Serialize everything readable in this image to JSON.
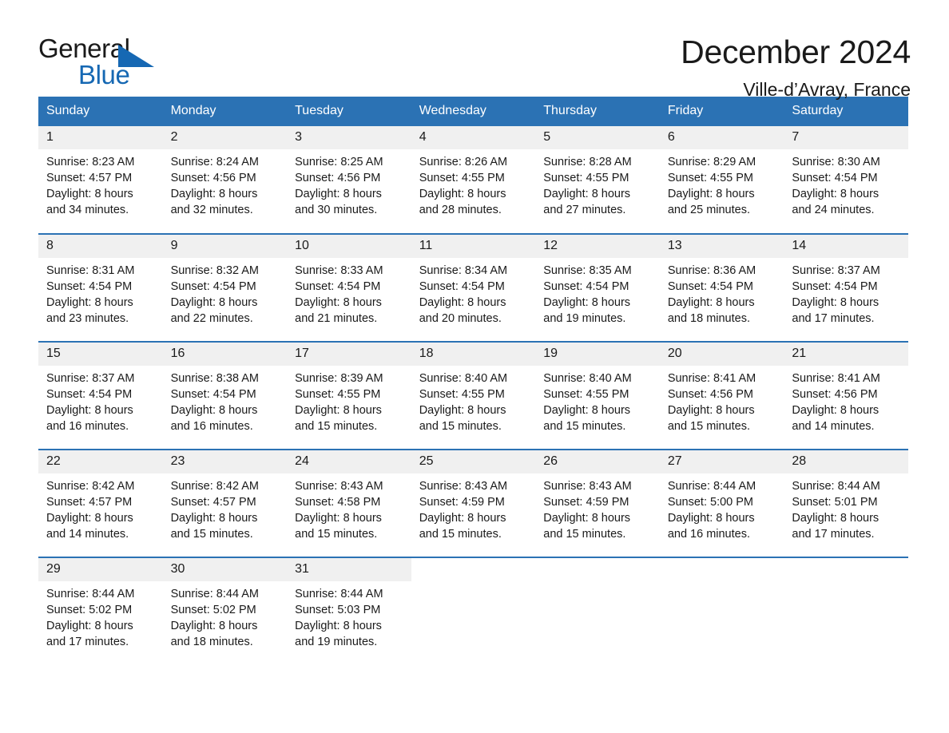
{
  "brand": {
    "name_part1": "General",
    "name_part2": "Blue",
    "triangle_color": "#1668b3",
    "accent_color": "#2b72b4"
  },
  "header": {
    "title": "December 2024",
    "subtitle": "Ville-d’Avray, France"
  },
  "calendar": {
    "weekday_headers": [
      "Sunday",
      "Monday",
      "Tuesday",
      "Wednesday",
      "Thursday",
      "Friday",
      "Saturday"
    ],
    "weeks": [
      [
        {
          "day": "1",
          "sunrise": "Sunrise: 8:23 AM",
          "sunset": "Sunset: 4:57 PM",
          "daylight_line1": "Daylight: 8 hours",
          "daylight_line2": "and 34 minutes."
        },
        {
          "day": "2",
          "sunrise": "Sunrise: 8:24 AM",
          "sunset": "Sunset: 4:56 PM",
          "daylight_line1": "Daylight: 8 hours",
          "daylight_line2": "and 32 minutes."
        },
        {
          "day": "3",
          "sunrise": "Sunrise: 8:25 AM",
          "sunset": "Sunset: 4:56 PM",
          "daylight_line1": "Daylight: 8 hours",
          "daylight_line2": "and 30 minutes."
        },
        {
          "day": "4",
          "sunrise": "Sunrise: 8:26 AM",
          "sunset": "Sunset: 4:55 PM",
          "daylight_line1": "Daylight: 8 hours",
          "daylight_line2": "and 28 minutes."
        },
        {
          "day": "5",
          "sunrise": "Sunrise: 8:28 AM",
          "sunset": "Sunset: 4:55 PM",
          "daylight_line1": "Daylight: 8 hours",
          "daylight_line2": "and 27 minutes."
        },
        {
          "day": "6",
          "sunrise": "Sunrise: 8:29 AM",
          "sunset": "Sunset: 4:55 PM",
          "daylight_line1": "Daylight: 8 hours",
          "daylight_line2": "and 25 minutes."
        },
        {
          "day": "7",
          "sunrise": "Sunrise: 8:30 AM",
          "sunset": "Sunset: 4:54 PM",
          "daylight_line1": "Daylight: 8 hours",
          "daylight_line2": "and 24 minutes."
        }
      ],
      [
        {
          "day": "8",
          "sunrise": "Sunrise: 8:31 AM",
          "sunset": "Sunset: 4:54 PM",
          "daylight_line1": "Daylight: 8 hours",
          "daylight_line2": "and 23 minutes."
        },
        {
          "day": "9",
          "sunrise": "Sunrise: 8:32 AM",
          "sunset": "Sunset: 4:54 PM",
          "daylight_line1": "Daylight: 8 hours",
          "daylight_line2": "and 22 minutes."
        },
        {
          "day": "10",
          "sunrise": "Sunrise: 8:33 AM",
          "sunset": "Sunset: 4:54 PM",
          "daylight_line1": "Daylight: 8 hours",
          "daylight_line2": "and 21 minutes."
        },
        {
          "day": "11",
          "sunrise": "Sunrise: 8:34 AM",
          "sunset": "Sunset: 4:54 PM",
          "daylight_line1": "Daylight: 8 hours",
          "daylight_line2": "and 20 minutes."
        },
        {
          "day": "12",
          "sunrise": "Sunrise: 8:35 AM",
          "sunset": "Sunset: 4:54 PM",
          "daylight_line1": "Daylight: 8 hours",
          "daylight_line2": "and 19 minutes."
        },
        {
          "day": "13",
          "sunrise": "Sunrise: 8:36 AM",
          "sunset": "Sunset: 4:54 PM",
          "daylight_line1": "Daylight: 8 hours",
          "daylight_line2": "and 18 minutes."
        },
        {
          "day": "14",
          "sunrise": "Sunrise: 8:37 AM",
          "sunset": "Sunset: 4:54 PM",
          "daylight_line1": "Daylight: 8 hours",
          "daylight_line2": "and 17 minutes."
        }
      ],
      [
        {
          "day": "15",
          "sunrise": "Sunrise: 8:37 AM",
          "sunset": "Sunset: 4:54 PM",
          "daylight_line1": "Daylight: 8 hours",
          "daylight_line2": "and 16 minutes."
        },
        {
          "day": "16",
          "sunrise": "Sunrise: 8:38 AM",
          "sunset": "Sunset: 4:54 PM",
          "daylight_line1": "Daylight: 8 hours",
          "daylight_line2": "and 16 minutes."
        },
        {
          "day": "17",
          "sunrise": "Sunrise: 8:39 AM",
          "sunset": "Sunset: 4:55 PM",
          "daylight_line1": "Daylight: 8 hours",
          "daylight_line2": "and 15 minutes."
        },
        {
          "day": "18",
          "sunrise": "Sunrise: 8:40 AM",
          "sunset": "Sunset: 4:55 PM",
          "daylight_line1": "Daylight: 8 hours",
          "daylight_line2": "and 15 minutes."
        },
        {
          "day": "19",
          "sunrise": "Sunrise: 8:40 AM",
          "sunset": "Sunset: 4:55 PM",
          "daylight_line1": "Daylight: 8 hours",
          "daylight_line2": "and 15 minutes."
        },
        {
          "day": "20",
          "sunrise": "Sunrise: 8:41 AM",
          "sunset": "Sunset: 4:56 PM",
          "daylight_line1": "Daylight: 8 hours",
          "daylight_line2": "and 15 minutes."
        },
        {
          "day": "21",
          "sunrise": "Sunrise: 8:41 AM",
          "sunset": "Sunset: 4:56 PM",
          "daylight_line1": "Daylight: 8 hours",
          "daylight_line2": "and 14 minutes."
        }
      ],
      [
        {
          "day": "22",
          "sunrise": "Sunrise: 8:42 AM",
          "sunset": "Sunset: 4:57 PM",
          "daylight_line1": "Daylight: 8 hours",
          "daylight_line2": "and 14 minutes."
        },
        {
          "day": "23",
          "sunrise": "Sunrise: 8:42 AM",
          "sunset": "Sunset: 4:57 PM",
          "daylight_line1": "Daylight: 8 hours",
          "daylight_line2": "and 15 minutes."
        },
        {
          "day": "24",
          "sunrise": "Sunrise: 8:43 AM",
          "sunset": "Sunset: 4:58 PM",
          "daylight_line1": "Daylight: 8 hours",
          "daylight_line2": "and 15 minutes."
        },
        {
          "day": "25",
          "sunrise": "Sunrise: 8:43 AM",
          "sunset": "Sunset: 4:59 PM",
          "daylight_line1": "Daylight: 8 hours",
          "daylight_line2": "and 15 minutes."
        },
        {
          "day": "26",
          "sunrise": "Sunrise: 8:43 AM",
          "sunset": "Sunset: 4:59 PM",
          "daylight_line1": "Daylight: 8 hours",
          "daylight_line2": "and 15 minutes."
        },
        {
          "day": "27",
          "sunrise": "Sunrise: 8:44 AM",
          "sunset": "Sunset: 5:00 PM",
          "daylight_line1": "Daylight: 8 hours",
          "daylight_line2": "and 16 minutes."
        },
        {
          "day": "28",
          "sunrise": "Sunrise: 8:44 AM",
          "sunset": "Sunset: 5:01 PM",
          "daylight_line1": "Daylight: 8 hours",
          "daylight_line2": "and 17 minutes."
        }
      ],
      [
        {
          "day": "29",
          "sunrise": "Sunrise: 8:44 AM",
          "sunset": "Sunset: 5:02 PM",
          "daylight_line1": "Daylight: 8 hours",
          "daylight_line2": "and 17 minutes."
        },
        {
          "day": "30",
          "sunrise": "Sunrise: 8:44 AM",
          "sunset": "Sunset: 5:02 PM",
          "daylight_line1": "Daylight: 8 hours",
          "daylight_line2": "and 18 minutes."
        },
        {
          "day": "31",
          "sunrise": "Sunrise: 8:44 AM",
          "sunset": "Sunset: 5:03 PM",
          "daylight_line1": "Daylight: 8 hours",
          "daylight_line2": "and 19 minutes."
        },
        {
          "day": "",
          "sunrise": "",
          "sunset": "",
          "daylight_line1": "",
          "daylight_line2": ""
        },
        {
          "day": "",
          "sunrise": "",
          "sunset": "",
          "daylight_line1": "",
          "daylight_line2": ""
        },
        {
          "day": "",
          "sunrise": "",
          "sunset": "",
          "daylight_line1": "",
          "daylight_line2": ""
        },
        {
          "day": "",
          "sunrise": "",
          "sunset": "",
          "daylight_line1": "",
          "daylight_line2": ""
        }
      ]
    ]
  }
}
